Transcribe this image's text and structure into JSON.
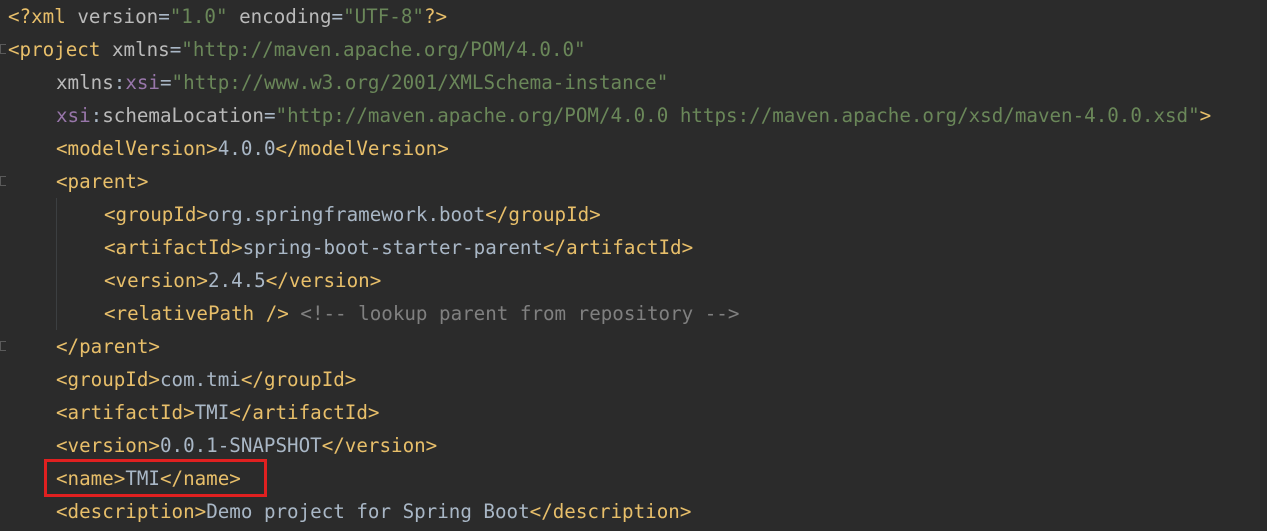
{
  "editor": {
    "language": "XML",
    "theme": "Darcula",
    "lines": [
      {
        "indent": 0,
        "parts": [
          {
            "type": "tag",
            "text": "<?xml "
          },
          {
            "type": "attr",
            "text": "version"
          },
          {
            "type": "txt",
            "text": "="
          },
          {
            "type": "val",
            "text": "\"1.0\""
          },
          {
            "type": "txt",
            "text": " "
          },
          {
            "type": "attr",
            "text": "encoding"
          },
          {
            "type": "txt",
            "text": "="
          },
          {
            "type": "val",
            "text": "\"UTF-8\""
          },
          {
            "type": "tag",
            "text": "?>"
          }
        ]
      },
      {
        "indent": 0,
        "parts": [
          {
            "type": "tag",
            "text": "<project "
          },
          {
            "type": "attr",
            "text": "xmlns"
          },
          {
            "type": "txt",
            "text": "="
          },
          {
            "type": "val",
            "text": "\"http://maven.apache.org/POM/4.0.0\""
          }
        ]
      },
      {
        "indent": 1,
        "parts": [
          {
            "type": "attr",
            "text": "xmlns"
          },
          {
            "type": "txt",
            "text": ":"
          },
          {
            "type": "ns",
            "text": "xsi"
          },
          {
            "type": "txt",
            "text": "="
          },
          {
            "type": "val",
            "text": "\"http://www.w3.org/2001/XMLSchema-instance\""
          }
        ]
      },
      {
        "indent": 1,
        "parts": [
          {
            "type": "ns",
            "text": "xsi"
          },
          {
            "type": "txt",
            "text": ":"
          },
          {
            "type": "attr",
            "text": "schemaLocation"
          },
          {
            "type": "txt",
            "text": "="
          },
          {
            "type": "val",
            "text": "\"http://maven.apache.org/POM/4.0.0 https://maven.apache.org/xsd/maven-4.0.0.xsd\""
          },
          {
            "type": "tag",
            "text": ">"
          }
        ]
      },
      {
        "indent": 1,
        "parts": [
          {
            "type": "tag",
            "text": "<modelVersion>"
          },
          {
            "type": "txt",
            "text": "4.0.0"
          },
          {
            "type": "tag",
            "text": "</modelVersion>"
          }
        ]
      },
      {
        "indent": 1,
        "parts": [
          {
            "type": "tag",
            "text": "<parent>"
          }
        ]
      },
      {
        "indent": 2,
        "parts": [
          {
            "type": "tag",
            "text": "<groupId>"
          },
          {
            "type": "txt",
            "text": "org.springframework.boot"
          },
          {
            "type": "tag",
            "text": "</groupId>"
          }
        ]
      },
      {
        "indent": 2,
        "parts": [
          {
            "type": "tag",
            "text": "<artifactId>"
          },
          {
            "type": "txt",
            "text": "spring-boot-starter-parent"
          },
          {
            "type": "tag",
            "text": "</artifactId>"
          }
        ]
      },
      {
        "indent": 2,
        "parts": [
          {
            "type": "tag",
            "text": "<version>"
          },
          {
            "type": "txt",
            "text": "2.4.5"
          },
          {
            "type": "tag",
            "text": "</version>"
          }
        ]
      },
      {
        "indent": 2,
        "parts": [
          {
            "type": "tag",
            "text": "<relativePath />"
          },
          {
            "type": "txt",
            "text": " "
          },
          {
            "type": "comment",
            "text": "<!-- lookup parent from repository -->"
          }
        ]
      },
      {
        "indent": 1,
        "parts": [
          {
            "type": "tag",
            "text": "</parent>"
          }
        ]
      },
      {
        "indent": 1,
        "parts": [
          {
            "type": "tag",
            "text": "<groupId>"
          },
          {
            "type": "txt",
            "text": "com.tmi"
          },
          {
            "type": "tag",
            "text": "</groupId>"
          }
        ]
      },
      {
        "indent": 1,
        "parts": [
          {
            "type": "tag",
            "text": "<artifactId>"
          },
          {
            "type": "txt",
            "text": "TMI"
          },
          {
            "type": "tag",
            "text": "</artifactId>"
          }
        ]
      },
      {
        "indent": 1,
        "parts": [
          {
            "type": "tag",
            "text": "<version>"
          },
          {
            "type": "txt",
            "text": "0.0.1-SNAPSHOT"
          },
          {
            "type": "tag",
            "text": "</version>"
          }
        ]
      },
      {
        "indent": 1,
        "parts": [
          {
            "type": "tag",
            "text": "<name>"
          },
          {
            "type": "txt",
            "text": "TMI"
          },
          {
            "type": "tag",
            "text": "</name>"
          }
        ]
      },
      {
        "indent": 1,
        "parts": [
          {
            "type": "tag",
            "text": "<description>"
          },
          {
            "type": "txt",
            "text": "Demo project for Spring Boot"
          },
          {
            "type": "tag",
            "text": "</description>"
          }
        ]
      }
    ]
  },
  "annotation": {
    "highlighted_line": "<name>TMI</name>",
    "box_color": "#e02020"
  },
  "colors": {
    "background": "#2b2b2b",
    "tag": "#e8bf6a",
    "attribute": "#bababa",
    "namespace": "#9876aa",
    "value": "#6a8759",
    "text": "#a9b7c6",
    "comment": "#808080"
  }
}
